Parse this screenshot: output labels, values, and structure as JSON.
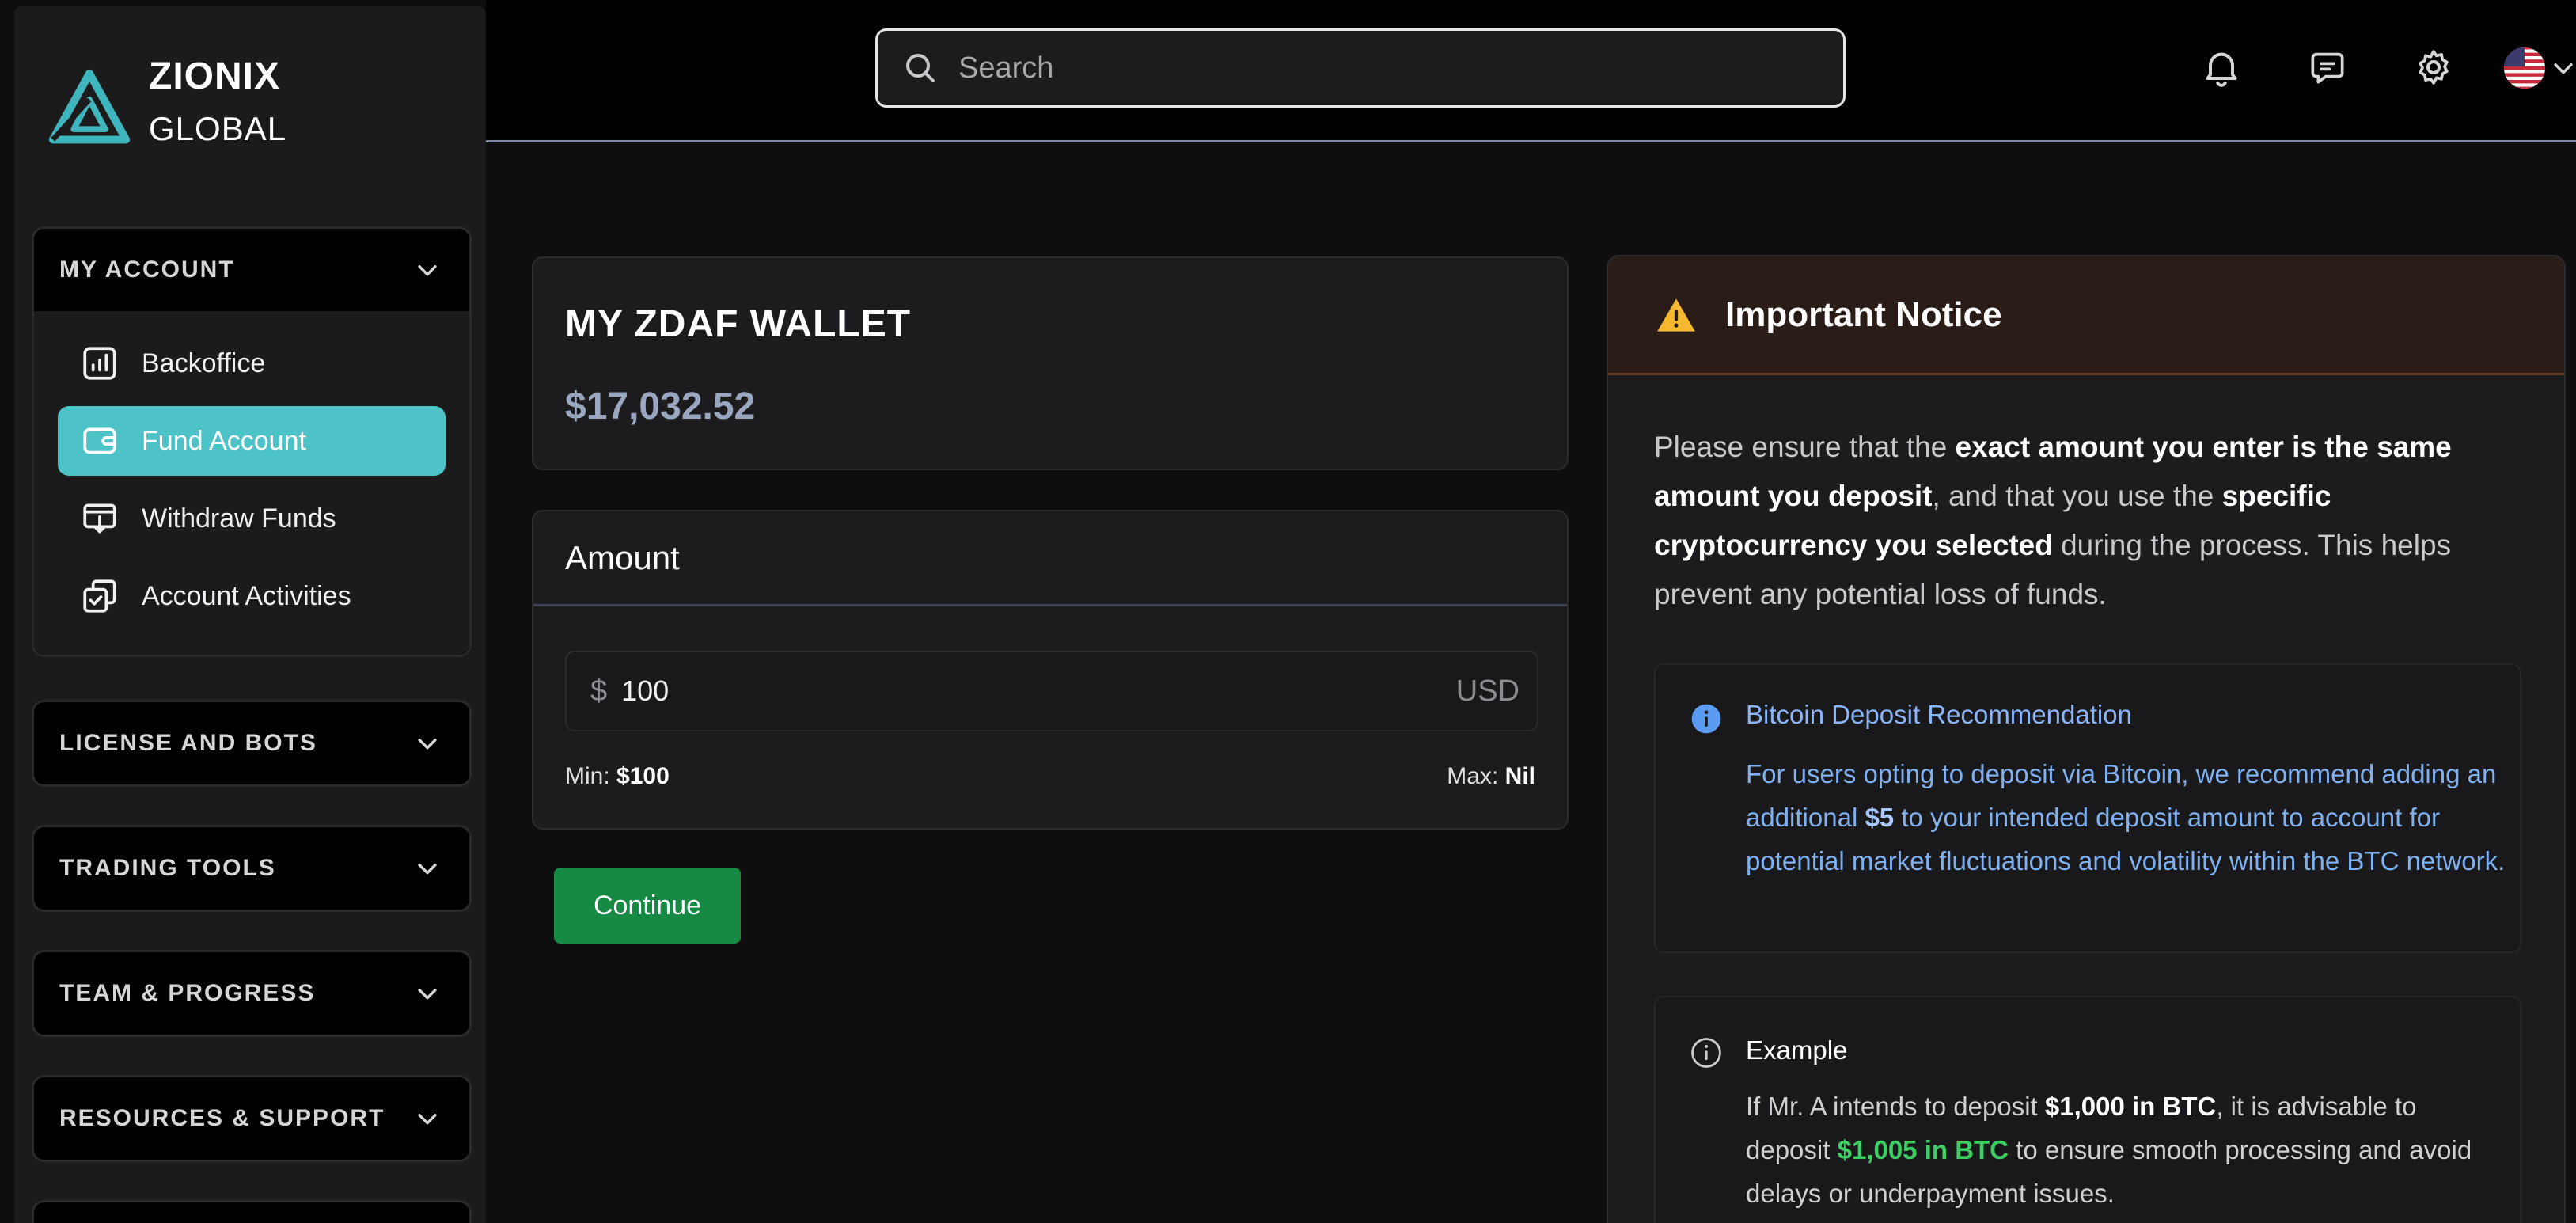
{
  "brand": {
    "line1": "ZIONIX",
    "line2": "GLOBAL",
    "accent": "#4dc3c8"
  },
  "header": {
    "search_placeholder": "Search",
    "icons": [
      "bell-icon",
      "chat-icon",
      "gear-icon",
      "us-flag-icon",
      "chevron-down-icon"
    ]
  },
  "sidebar": {
    "groups": [
      {
        "label": "MY ACCOUNT",
        "expanded": true,
        "items": [
          {
            "label": "Backoffice",
            "icon": "chart-icon"
          },
          {
            "label": "Fund Account",
            "icon": "wallet-icon",
            "active": true
          },
          {
            "label": "Withdraw Funds",
            "icon": "withdraw-icon"
          },
          {
            "label": "Account Activities",
            "icon": "activities-icon"
          }
        ]
      },
      {
        "label": "LICENSE AND BOTS"
      },
      {
        "label": "TRADING TOOLS"
      },
      {
        "label": "TEAM & PROGRESS"
      },
      {
        "label": "RESOURCES & SUPPORT"
      }
    ]
  },
  "wallet": {
    "title": "MY ZDAF WALLET",
    "balance": "$17,032.52"
  },
  "amount": {
    "title": "Amount",
    "prefix": "$",
    "value": "100",
    "currency": "USD",
    "min_label": "Min:",
    "min_value": "$100",
    "max_label": "Max:",
    "max_value": "Nil"
  },
  "continue_label": "Continue",
  "notice": {
    "title": "Important Notice",
    "text": {
      "p1": "Please ensure that the ",
      "b1": "exact amount you enter is the same amount you deposit",
      "p2": ", and that you use the ",
      "b2": "specific cryptocurrency you selected",
      "p3": " during the process. This helps prevent any potential loss of funds."
    },
    "btc": {
      "title": "Bitcoin Deposit Recommendation",
      "p1": "For users opting to deposit via Bitcoin, we recommend adding an additional ",
      "b1": "$5",
      "p2": " to your intended deposit amount to account for potential market fluctuations and volatility within the BTC network."
    },
    "example": {
      "title": "Example",
      "p1": "If Mr. A intends to deposit ",
      "b1": "$1,000 in BTC",
      "p2": ", it is advisable to deposit ",
      "g1": "$1,005 in BTC",
      "p3": " to ensure smooth processing and avoid delays or underpayment issues."
    }
  }
}
